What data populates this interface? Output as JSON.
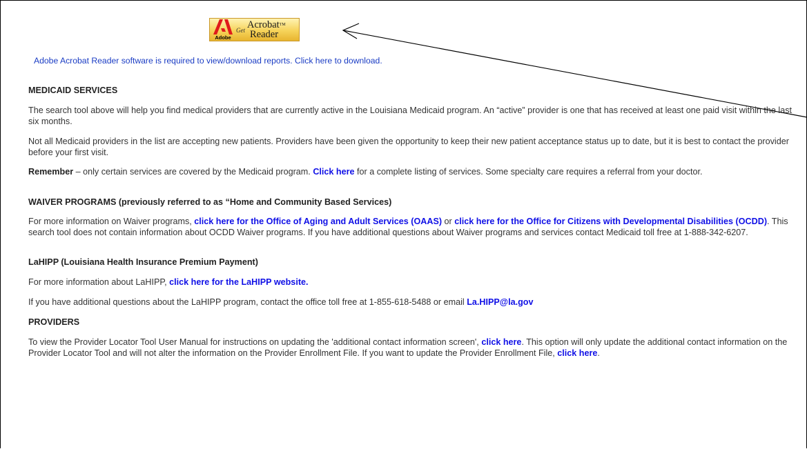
{
  "acrobat_badge": {
    "vendor": "Adobe",
    "get": "Get",
    "word1": "Acrobat",
    "word2": "Reader",
    "tm": "TM"
  },
  "download_notice": "Adobe Acrobat Reader software is required to view/download reports.  Click here to download.",
  "medicaid": {
    "heading": "MEDICAID SERVICES",
    "p1": "The search tool above will help you find medical providers that are currently active in the Louisiana Medicaid program. An “active” provider is one that has received at least one paid visit within the last six months.",
    "p2": "Not all Medicaid providers in the list are accepting new patients. Providers have been given the opportunity to keep their new patient acceptance status up to date, but it is best to contact the provider before your first visit.",
    "p3_bold": "Remember",
    "p3_a": " – only certain services are covered by the Medicaid program. ",
    "p3_link": "Click here",
    "p3_b": " for a complete listing of services. Some specialty care requires a referral from your doctor."
  },
  "waiver": {
    "heading": "WAIVER PROGRAMS (previously referred to as “Home and Community Based Services)",
    "p_a": "For more information on Waiver programs, ",
    "link1": "click here for the Office of Aging and Adult Services (OAAS)",
    "p_b": " or ",
    "link2": "click here for the Office for Citizens with Developmental Disabilities (OCDD)",
    "p_c": ". This search tool does not contain information about OCDD Waiver programs. If you have additional questions about Waiver programs and services contact Medicaid toll free at 1-888-342-6207."
  },
  "lahipp": {
    "heading": "LaHIPP (Louisiana Health Insurance Premium Payment)",
    "p1_a": "For more information about LaHIPP, ",
    "p1_link": "click here for the LaHIPP website.",
    "p2_a": "If you have additional questions about the LaHIPP program, contact the office toll free at 1-855-618-5488 or email ",
    "p2_link": "La.HIPP@la.gov"
  },
  "providers": {
    "heading": "PROVIDERS",
    "p_a": "To view the Provider Locator Tool User Manual for instructions on updating the 'additional contact information screen',  ",
    "link1": "click here",
    "p_b": ". This option will only update the additional contact information on the Provider Locator Tool and will not alter the information on the Provider Enrollment File. If you want to update the Provider Enrollment File, ",
    "link2": "click here",
    "p_c": "."
  },
  "colors": {
    "link": "#1010e6",
    "notice": "#1a3cc4",
    "badge_gold": "#f6d35a",
    "adobe_red": "#e01b1b"
  }
}
